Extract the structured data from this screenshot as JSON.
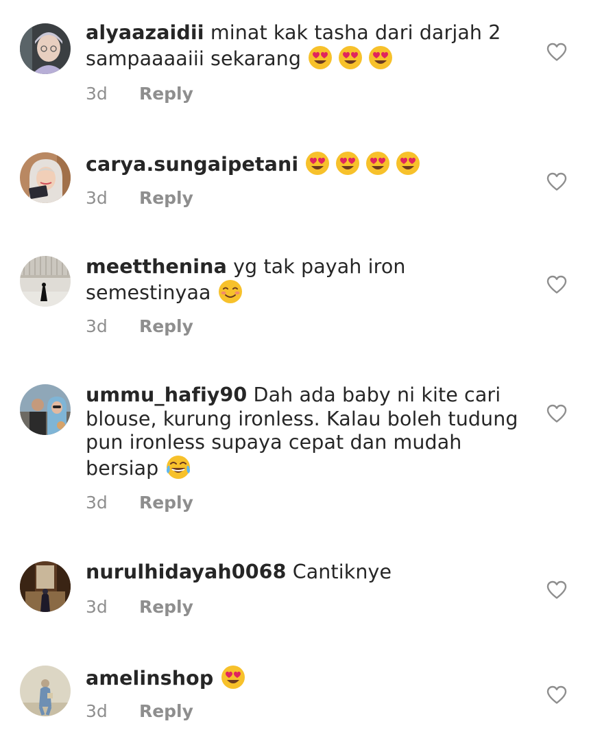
{
  "comments": [
    {
      "user": "alyaazaidii",
      "text": "minat kak tasha dari darjah 2 sampaaaaiii sekarang",
      "emojis": [
        "heart-eyes-emoji",
        "heart-eyes-emoji",
        "heart-eyes-emoji"
      ],
      "time": "3d",
      "reply": "Reply"
    },
    {
      "user": "carya.sungaipetani",
      "text": "",
      "emojis": [
        "heart-eyes-emoji",
        "heart-eyes-emoji",
        "heart-eyes-emoji",
        "heart-eyes-emoji"
      ],
      "time": "3d",
      "reply": "Reply"
    },
    {
      "user": "meetthenina",
      "text": "yg tak payah iron semestinyaa",
      "emojis": [
        "smiling-blush-emoji"
      ],
      "time": "3d",
      "reply": "Reply"
    },
    {
      "user": "ummu_hafiy90",
      "text": "Dah ada baby ni kite cari blouse, kurung ironless. Kalau boleh tudung pun ironless supaya cepat dan mudah bersiap",
      "emojis": [
        "tears-of-joy-emoji"
      ],
      "time": "3d",
      "reply": "Reply"
    },
    {
      "user": "nurulhidayah0068",
      "text": "Cantiknye",
      "emojis": [],
      "time": "3d",
      "reply": "Reply"
    },
    {
      "user": "amelinshop",
      "text": "",
      "emojis": [
        "heart-eyes-emoji"
      ],
      "time": "3d",
      "reply": "Reply"
    }
  ],
  "colors": {
    "text": "#262626",
    "meta": "#8e8e8e",
    "heart": "#8e8e8e",
    "emoji_face": "#f7c12b"
  }
}
